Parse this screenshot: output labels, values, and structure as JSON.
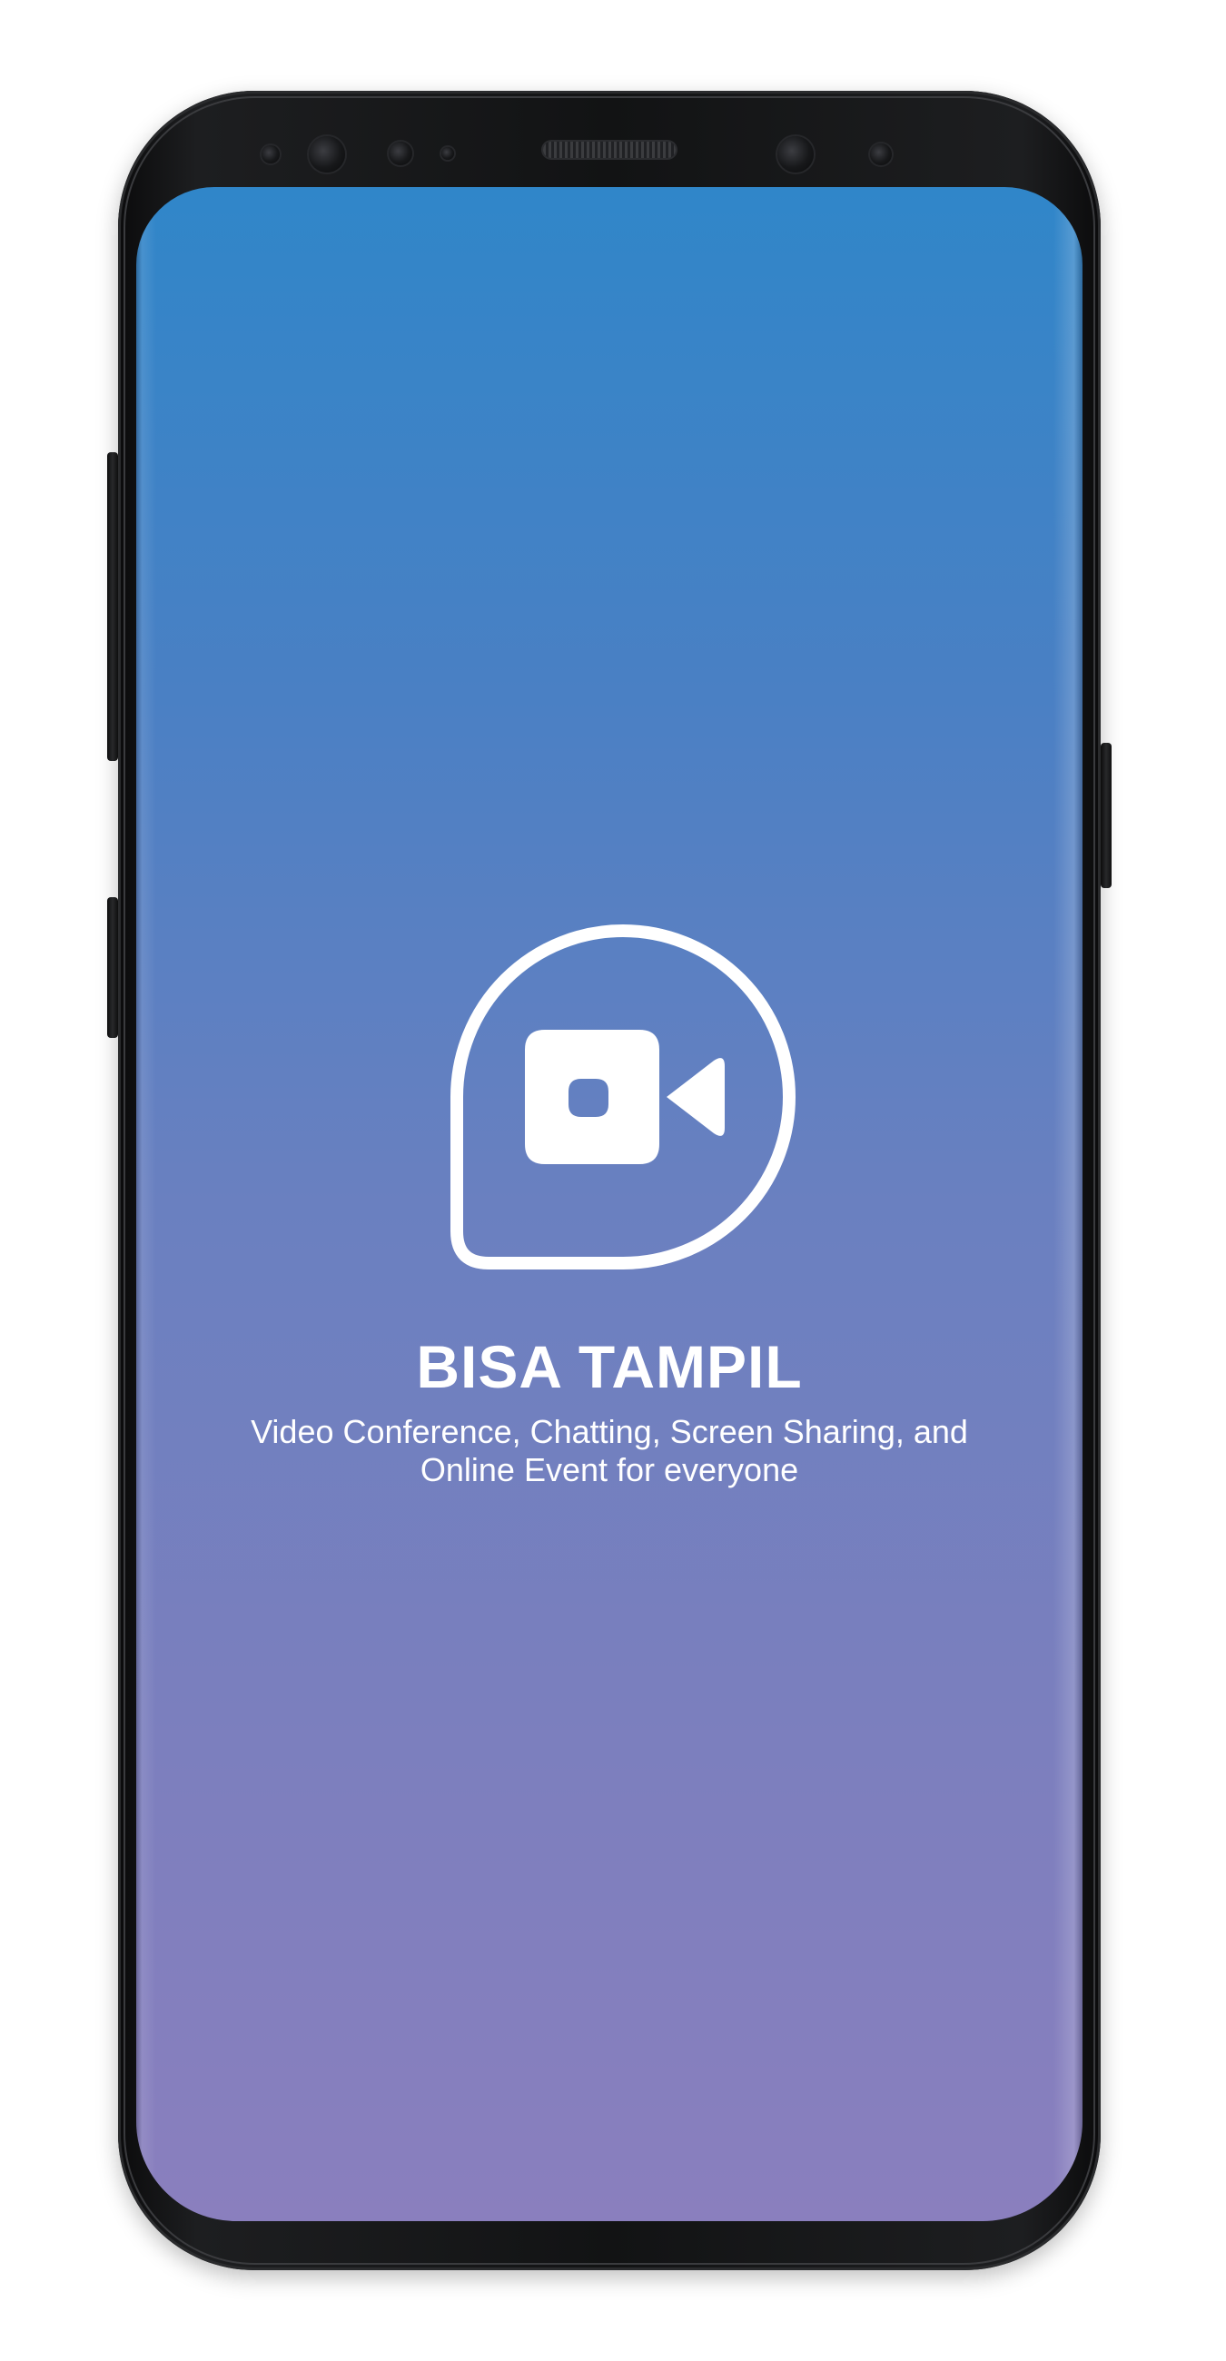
{
  "app": {
    "name": "BISA TAMPIL",
    "tagline": "Video Conference, Chatting, Screen Sharing, and Online Event for everyone",
    "logo_icon": "video-camera-chat-bubble-icon"
  },
  "colors": {
    "gradient_top": "#3086c9",
    "gradient_bottom": "#8a7fbe",
    "foreground": "#ffffff",
    "device_frame": "#121314"
  }
}
